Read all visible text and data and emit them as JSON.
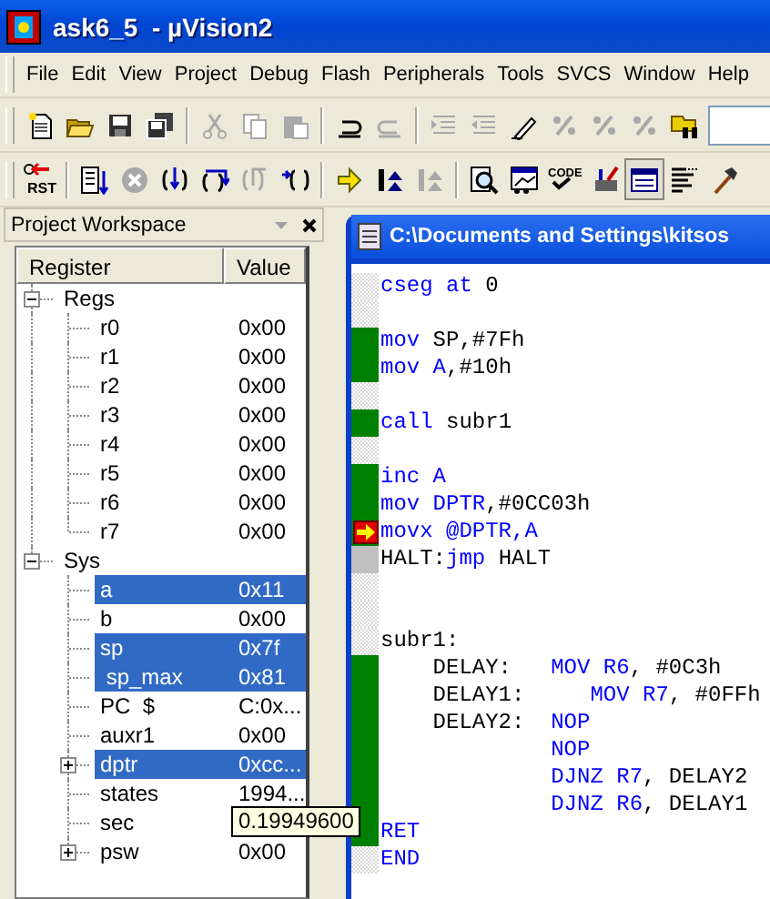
{
  "window": {
    "title": "ask6_5  - µVision2"
  },
  "menu": [
    {
      "label": "File"
    },
    {
      "label": "Edit"
    },
    {
      "label": "View"
    },
    {
      "label": "Project"
    },
    {
      "label": "Debug"
    },
    {
      "label": "Flash"
    },
    {
      "label": "Peripherals"
    },
    {
      "label": "Tools"
    },
    {
      "label": "SVCS"
    },
    {
      "label": "Window"
    },
    {
      "label": "Help"
    }
  ],
  "toolbars": [
    {
      "items": [
        {
          "kind": "button",
          "disabled": false
        },
        {
          "kind": "button",
          "disabled": false
        },
        {
          "kind": "button",
          "disabled": false
        },
        {
          "kind": "button",
          "disabled": false
        },
        {
          "kind": "separator"
        },
        {
          "kind": "button",
          "disabled": true
        },
        {
          "kind": "button",
          "disabled": true
        },
        {
          "kind": "button",
          "disabled": true
        },
        {
          "kind": "separator"
        },
        {
          "kind": "button",
          "disabled": false
        },
        {
          "kind": "button",
          "disabled": true
        },
        {
          "kind": "separator"
        },
        {
          "kind": "button",
          "disabled": true
        },
        {
          "kind": "button",
          "disabled": true
        },
        {
          "kind": "button",
          "disabled": false
        },
        {
          "kind": "button",
          "disabled": true
        },
        {
          "kind": "button",
          "disabled": true
        },
        {
          "kind": "button",
          "disabled": true
        },
        {
          "kind": "button",
          "disabled": false
        },
        {
          "kind": "field"
        }
      ]
    },
    {
      "items": [
        {
          "kind": "button",
          "disabled": false,
          "label": "RST"
        },
        {
          "kind": "separator"
        },
        {
          "kind": "button",
          "disabled": false
        },
        {
          "kind": "button",
          "disabled": true
        },
        {
          "kind": "button",
          "disabled": false
        },
        {
          "kind": "button",
          "disabled": false
        },
        {
          "kind": "button",
          "disabled": true
        },
        {
          "kind": "button",
          "disabled": false
        },
        {
          "kind": "separator"
        },
        {
          "kind": "button",
          "disabled": false
        },
        {
          "kind": "button",
          "disabled": false
        },
        {
          "kind": "button",
          "disabled": true
        },
        {
          "kind": "separator"
        },
        {
          "kind": "button",
          "disabled": false
        },
        {
          "kind": "button",
          "disabled": false
        },
        {
          "kind": "button",
          "disabled": false,
          "label": "CODE"
        },
        {
          "kind": "button",
          "disabled": false
        },
        {
          "kind": "button",
          "disabled": false,
          "pressed": true
        },
        {
          "kind": "button",
          "disabled": false
        },
        {
          "kind": "button",
          "disabled": false
        }
      ]
    }
  ],
  "workspace": {
    "title": "Project Workspace",
    "columns": [
      "Register",
      "Value"
    ],
    "tree": [
      {
        "name": "Regs",
        "expanded": true,
        "children": [
          {
            "name": "r0",
            "value": "0x00",
            "selected": false
          },
          {
            "name": "r1",
            "value": "0x00",
            "selected": false
          },
          {
            "name": "r2",
            "value": "0x00",
            "selected": false
          },
          {
            "name": "r3",
            "value": "0x00",
            "selected": false
          },
          {
            "name": "r4",
            "value": "0x00",
            "selected": false
          },
          {
            "name": "r5",
            "value": "0x00",
            "selected": false
          },
          {
            "name": "r6",
            "value": "0x00",
            "selected": false
          },
          {
            "name": "r7",
            "value": "0x00",
            "selected": false
          }
        ]
      },
      {
        "name": "Sys",
        "expanded": true,
        "children": [
          {
            "name": "a",
            "value": "0x11",
            "selected": true
          },
          {
            "name": "b",
            "value": "0x00",
            "selected": false
          },
          {
            "name": "sp",
            "value": "0x7f",
            "selected": true
          },
          {
            "name": " sp_max",
            "value": "0x81",
            "selected": true
          },
          {
            "name": "PC  $",
            "value": "C:0x...",
            "selected": false
          },
          {
            "name": "auxr1",
            "value": "0x00",
            "selected": false
          },
          {
            "name": "dptr",
            "value": "0xcc...",
            "selected": true,
            "expanded": false
          },
          {
            "name": "states",
            "value": "1994...",
            "selected": false
          },
          {
            "name": "sec",
            "selected": false
          },
          {
            "name": "psw",
            "value": "0x00",
            "selected": false,
            "expanded": false
          }
        ]
      }
    ],
    "tooltip": "0.19949600"
  },
  "editor": {
    "title": "C:\\Documents and Settings\\kitsos",
    "lines": [
      {
        "kind": "code",
        "tokens": [
          {
            "text": "cseg at",
            "kind": "keyword"
          },
          {
            "text": " 0",
            "kind": "plain"
          }
        ]
      },
      {
        "kind": "blank"
      },
      {
        "executed": true,
        "current": false,
        "tokens": [
          {
            "text": "mov",
            "kind": "keyword"
          },
          {
            "text": " SP,#7Fh",
            "kind": "plain"
          }
        ]
      },
      {
        "executed": true,
        "current": false,
        "tokens": [
          {
            "text": "mov A",
            "kind": "keyword"
          },
          {
            "text": ",#10h",
            "kind": "plain"
          }
        ]
      },
      {
        "kind": "blank"
      },
      {
        "executed": true,
        "current": false,
        "tokens": [
          {
            "text": "call",
            "kind": "keyword"
          },
          {
            "text": " subr1",
            "kind": "plain"
          }
        ]
      },
      {
        "kind": "blank"
      },
      {
        "executed": true,
        "current": false,
        "tokens": [
          {
            "text": "inc A",
            "kind": "keyword"
          }
        ]
      },
      {
        "executed": true,
        "current": false,
        "tokens": [
          {
            "text": "mov DPTR",
            "kind": "keyword"
          },
          {
            "text": ",#0CC03h",
            "kind": "plain"
          }
        ]
      },
      {
        "executed": true,
        "current": true,
        "tokens": [
          {
            "text": "movx @DPTR,A",
            "kind": "keyword"
          }
        ]
      },
      {
        "executed": false,
        "current": false,
        "tokens": [
          {
            "text": "HALT:",
            "kind": "plain"
          },
          {
            "text": "jmp",
            "kind": "keyword"
          },
          {
            "text": " HALT",
            "kind": "plain"
          }
        ]
      },
      {
        "kind": "blank"
      },
      {
        "kind": "blank"
      },
      {
        "kind": "code",
        "tokens": [
          {
            "text": "subr1:",
            "kind": "plain"
          }
        ]
      },
      {
        "executed": true,
        "current": false,
        "label": "DELAY:",
        "tokens": [
          {
            "text": "MOV R6",
            "kind": "keyword"
          },
          {
            "text": ", #0C3h",
            "kind": "plain"
          }
        ]
      },
      {
        "executed": true,
        "current": false,
        "label": "DELAY1:",
        "tokens": [
          {
            "text": "   MOV R7",
            "kind": "keyword"
          },
          {
            "text": ", #0FFh",
            "kind": "plain"
          }
        ]
      },
      {
        "executed": true,
        "current": false,
        "label": "DELAY2:",
        "tokens": [
          {
            "text": "NOP",
            "kind": "keyword"
          }
        ]
      },
      {
        "executed": true,
        "current": false,
        "block": true,
        "tokens": [
          {
            "text": "NOP",
            "kind": "keyword"
          }
        ]
      },
      {
        "executed": true,
        "current": false,
        "block": true,
        "tokens": [
          {
            "text": "DJNZ R7",
            "kind": "keyword"
          },
          {
            "text": ", DELAY2",
            "kind": "plain"
          }
        ]
      },
      {
        "executed": true,
        "current": false,
        "block": true,
        "tokens": [
          {
            "text": "DJNZ R6",
            "kind": "keyword"
          },
          {
            "text": ", DELAY1",
            "kind": "plain"
          }
        ]
      },
      {
        "executed": true,
        "current": false,
        "tokens": [
          {
            "text": "RET",
            "kind": "keyword"
          }
        ]
      },
      {
        "kind": "code",
        "tokens": [
          {
            "text": "END",
            "kind": "keyword"
          }
        ]
      }
    ]
  }
}
